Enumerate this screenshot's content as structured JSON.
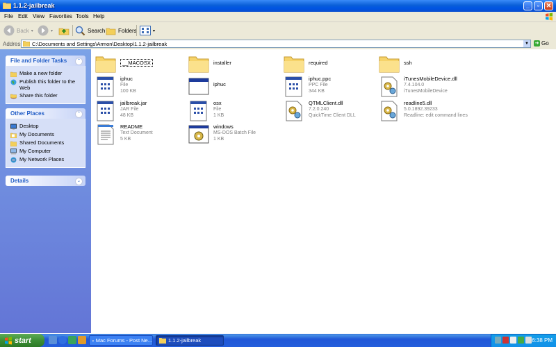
{
  "window": {
    "title": "1.1.2-jailbreak"
  },
  "menu": [
    "File",
    "Edit",
    "View",
    "Favorites",
    "Tools",
    "Help"
  ],
  "toolbar": {
    "back": "Back",
    "search": "Search",
    "folders": "Folders"
  },
  "address": {
    "label": "Address",
    "path": "C:\\Documents and Settings\\Armon\\Desktop\\1.1.2-jailbreak",
    "go": "Go"
  },
  "sidebar": {
    "tasks": {
      "title": "File and Folder Tasks",
      "items": [
        "Make a new folder",
        "Publish this folder to the Web",
        "Share this folder"
      ]
    },
    "places": {
      "title": "Other Places",
      "items": [
        "Desktop",
        "My Documents",
        "Shared Documents",
        "My Computer",
        "My Network Places"
      ]
    },
    "details": {
      "title": "Details"
    }
  },
  "files": [
    {
      "name": "__MACOSX",
      "type": "folder"
    },
    {
      "name": "installer",
      "type": "folder"
    },
    {
      "name": "required",
      "type": "folder"
    },
    {
      "name": "ssh",
      "type": "folder"
    },
    {
      "name": "iphuc",
      "line2": "File",
      "line3": "100 KB",
      "type": "file"
    },
    {
      "name": "iphuc",
      "line2": "",
      "line3": "",
      "type": "app"
    },
    {
      "name": "iphuc.ppc",
      "line2": "PPC File",
      "line3": "344 KB",
      "type": "file"
    },
    {
      "name": "iTunesMobileDevice.dll",
      "line2": "7.4.104.0",
      "line3": "iTunesMobileDevice",
      "type": "dll"
    },
    {
      "name": "jailbreak.jar",
      "line2": "JAR File",
      "line3": "48 KB",
      "type": "file"
    },
    {
      "name": "osx",
      "line2": "File",
      "line3": "1 KB",
      "type": "file"
    },
    {
      "name": "QTMLClient.dll",
      "line2": "7.2.0.240",
      "line3": "QuickTime Client DLL",
      "type": "dll"
    },
    {
      "name": "readline5.dll",
      "line2": "5.0.1892.39233",
      "line3": "Readline: edit command lines",
      "type": "dll"
    },
    {
      "name": "README",
      "line2": "Text Document",
      "line3": "5 KB",
      "type": "text"
    },
    {
      "name": "windows",
      "line2": "MS-DOS Batch File",
      "line3": "1 KB",
      "type": "batch"
    }
  ],
  "taskbar": {
    "start": "start",
    "buttons": [
      "Mac Forums - Post Ne...",
      "1.1.2-jailbreak"
    ],
    "clock": "6:38 PM"
  }
}
